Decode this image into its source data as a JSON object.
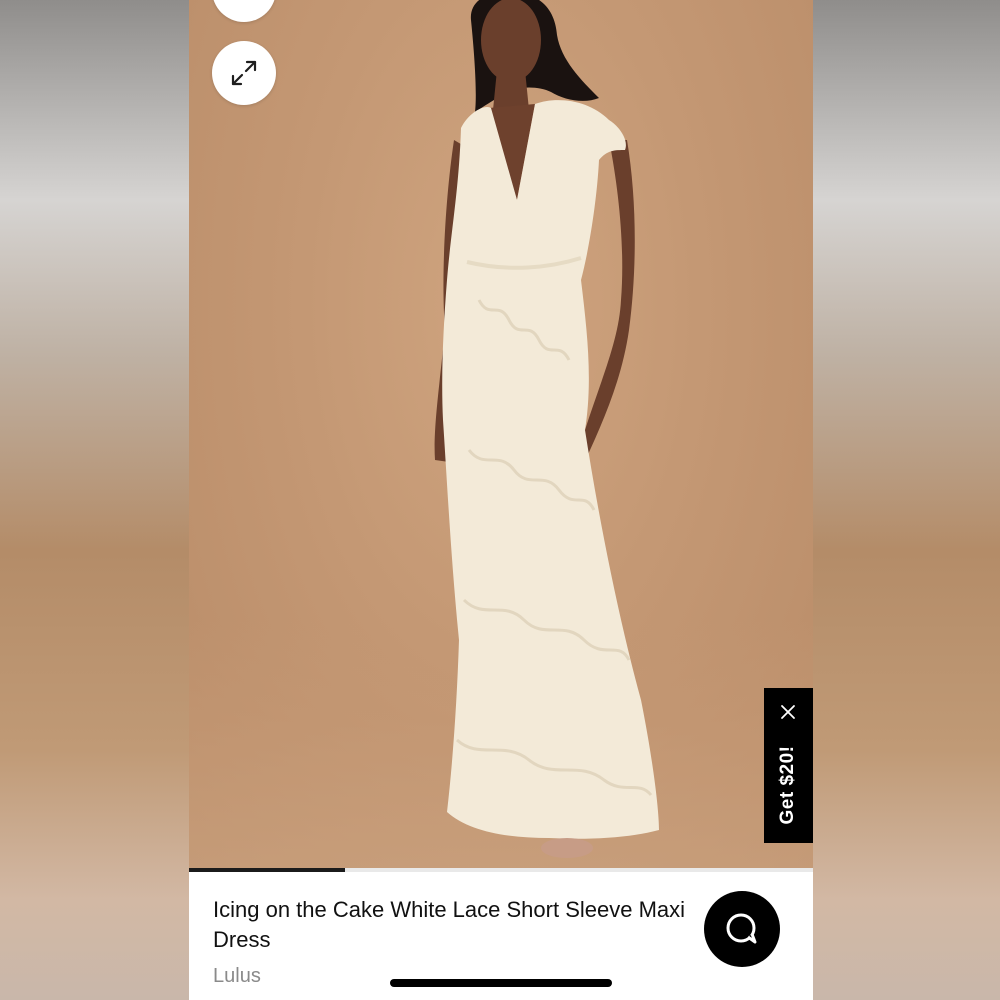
{
  "product": {
    "title": "Icing on the Cake White Lace Short Sleeve Maxi Dress",
    "brand": "Lulus",
    "image_progress": 0.25
  },
  "promo": {
    "label": "Get $20!",
    "close_icon": "close-icon"
  },
  "icons": {
    "top_button": "chevron-down-icon",
    "expand_button": "expand-icon",
    "chat_button": "chat-bubble-icon"
  },
  "colors": {
    "photo_background": "#c49874",
    "dress": "#f3ead8",
    "promo_background": "#000000",
    "chat_background": "#000000"
  }
}
